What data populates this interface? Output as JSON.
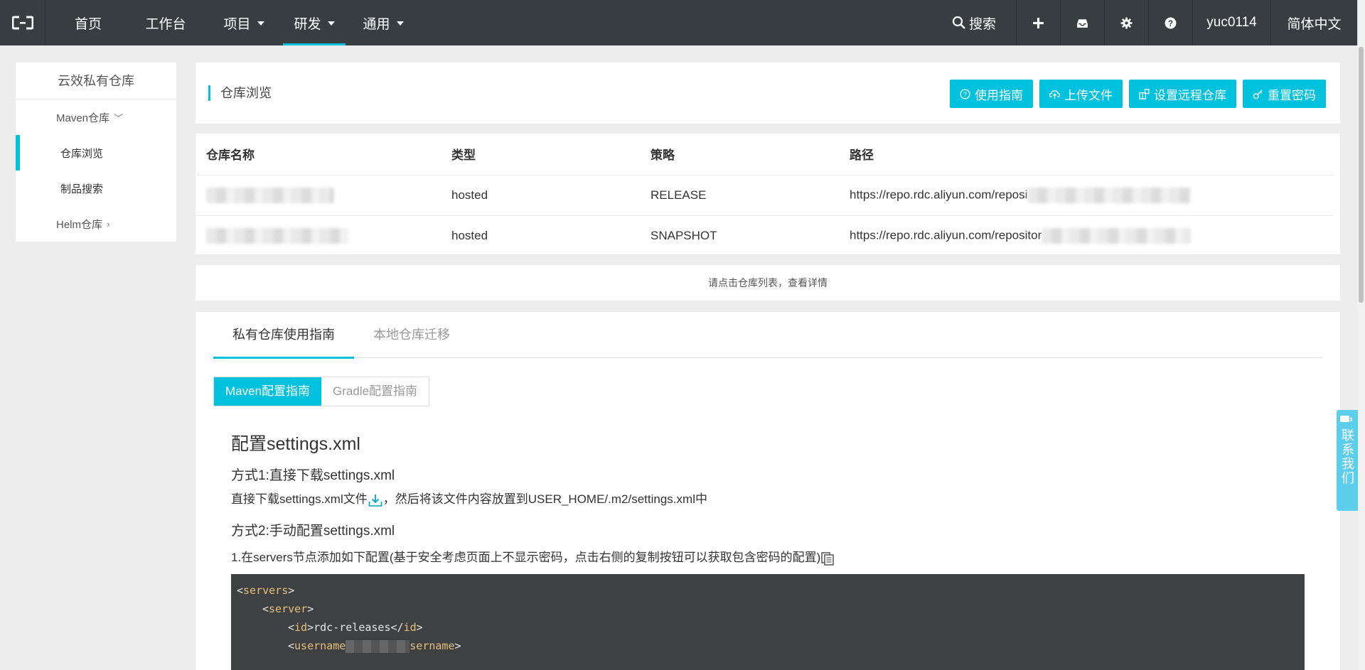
{
  "nav": {
    "items": [
      {
        "label": "首页"
      },
      {
        "label": "工作台"
      },
      {
        "label": "项目"
      },
      {
        "label": "研发"
      },
      {
        "label": "通用"
      }
    ],
    "search_label": "搜索",
    "user": "yuc0114",
    "language": "简体中文"
  },
  "sidebar": {
    "title": "云效私有仓库",
    "groups": [
      {
        "label": "Maven仓库"
      },
      {
        "label": "Helm仓库"
      }
    ],
    "items": [
      {
        "label": "仓库浏览"
      },
      {
        "label": "制品搜索"
      }
    ]
  },
  "header": {
    "title": "仓库浏览",
    "buttons": [
      {
        "label": "使用指南",
        "icon": "question-circle-icon"
      },
      {
        "label": "上传文件",
        "icon": "upload-cloud-icon"
      },
      {
        "label": "设置远程仓库",
        "icon": "remote-settings-icon"
      },
      {
        "label": "重置密码",
        "icon": "key-icon"
      }
    ]
  },
  "table": {
    "columns": [
      "仓库名称",
      "类型",
      "策略",
      "路径"
    ],
    "rows": [
      {
        "type": "hosted",
        "policy": "RELEASE",
        "path": "https://repo.rdc.aliyun.com/reposi"
      },
      {
        "type": "hosted",
        "policy": "SNAPSHOT",
        "path": "https://repo.rdc.aliyun.com/repositor"
      }
    ]
  },
  "hint": "请点击仓库列表，查看详情",
  "guide": {
    "tabs": [
      "私有仓库使用指南",
      "本地仓库迁移"
    ],
    "segments": [
      "Maven配置指南",
      "Gradle配置指南"
    ],
    "heading": "配置settings.xml",
    "method1_title": "方式1:直接下载settings.xml",
    "method1_text_a": "直接下载settings.xml文件",
    "method1_text_b": "，然后将该文件内容放置到USER_HOME/.m2/settings.xml中",
    "method2_title": "方式2:手动配置settings.xml",
    "step1_text": "1.在servers节点添加如下配置(基于安全考虑页面上不显示密码，点击右侧的复制按钮可以获取包含密码的配置)",
    "code": {
      "servers_tag": "servers",
      "server_tag": "server",
      "id_tag": "id",
      "id_value": "rdc-releases",
      "username_tag_start": "username",
      "username_tag_end": "sername"
    }
  },
  "contact": "联系我们",
  "colors": {
    "accent": "#00c1de",
    "nav_bg": "#373d41",
    "page_bg": "#ededed",
    "code_bg": "#3e4042"
  }
}
